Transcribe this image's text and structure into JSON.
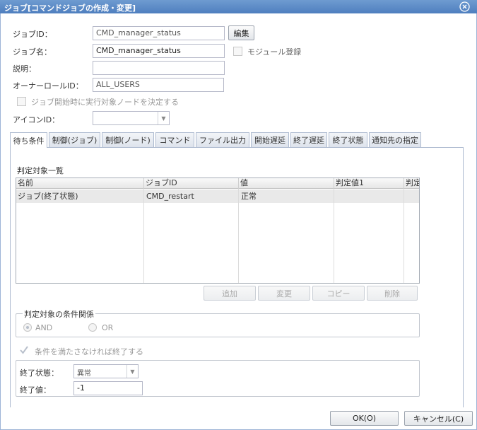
{
  "window": {
    "title": "ジョブ[コマンドジョブの作成・変更]"
  },
  "form": {
    "job_id_label": "ジョブID：",
    "job_id_value": "CMD_manager_status",
    "edit_button": "編集",
    "job_name_label": "ジョブ名：",
    "job_name_value": "CMD_manager_status",
    "module_register_label": "モジュール登録",
    "description_label": "説明：",
    "description_value": "",
    "owner_role_label": "オーナーロールID：",
    "owner_role_value": "ALL_USERS",
    "decide_node_label": "ジョブ開始時に実行対象ノードを決定する",
    "icon_id_label": "アイコンID：",
    "icon_id_value": ""
  },
  "tabs": [
    {
      "label": "待ち条件",
      "active": true
    },
    {
      "label": "制御(ジョブ)"
    },
    {
      "label": "制御(ノード)"
    },
    {
      "label": "コマンド"
    },
    {
      "label": "ファイル出力"
    },
    {
      "label": "開始遅延"
    },
    {
      "label": "終了遅延"
    },
    {
      "label": "終了状態"
    },
    {
      "label": "通知先の指定"
    }
  ],
  "wait_condition": {
    "list_title": "判定対象一覧",
    "columns": [
      "名前",
      "ジョブID",
      "値",
      "判定値1",
      "判定"
    ],
    "rows": [
      {
        "name": "ジョブ(終了状態)",
        "job_id": "CMD_restart",
        "value": "正常",
        "judge1": "",
        "judge2": ""
      }
    ],
    "buttons": {
      "add": "追加",
      "modify": "変更",
      "copy": "コピー",
      "delete": "削除"
    },
    "relation_legend": "判定対象の条件関係",
    "and_label": "AND",
    "or_label": "OR",
    "end_if_unmet_label": "条件を満たさなければ終了する",
    "end_status_label": "終了状態：",
    "end_status_value": "異常",
    "end_value_label": "終了値：",
    "end_value_value": "-1"
  },
  "footer": {
    "ok_button": "OK(O)",
    "cancel_button": "キャンセル(C)"
  }
}
